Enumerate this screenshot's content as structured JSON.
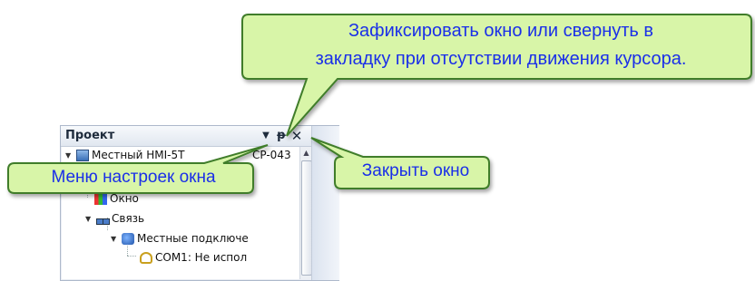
{
  "panel": {
    "title": "Проект",
    "menu_button_glyph": "▼",
    "pin_button_glyph": "ᵽ",
    "close_button_glyph": "✕",
    "scroll_up_glyph": "▲",
    "tree": [
      {
        "label": "Местный HMI-5T",
        "icon": "monitor-icon",
        "expanded": true
      },
      {
        "label": "Окно",
        "icon": "window-icon",
        "expanded": false
      },
      {
        "label": "Связь",
        "icon": "network-icon",
        "expanded": true
      },
      {
        "label": "Местные подключе",
        "icon": "local-connection-icon",
        "expanded": true
      },
      {
        "label": "COM1: Не испол",
        "icon": "com-port-icon",
        "expanded": false
      }
    ],
    "partial_header_text": "CP-043"
  },
  "callouts": {
    "top": {
      "line1": "Зафиксировать окно или свернуть в",
      "line2": "закладку при отсутствии движения курсора."
    },
    "menu": {
      "text": "Меню настроек окна"
    },
    "close": {
      "text": "Закрыть окно"
    }
  },
  "colors": {
    "callout_fill": "#d8f5a8",
    "callout_stroke": "#3f7d2a",
    "callout_text": "#1a2fe8"
  }
}
